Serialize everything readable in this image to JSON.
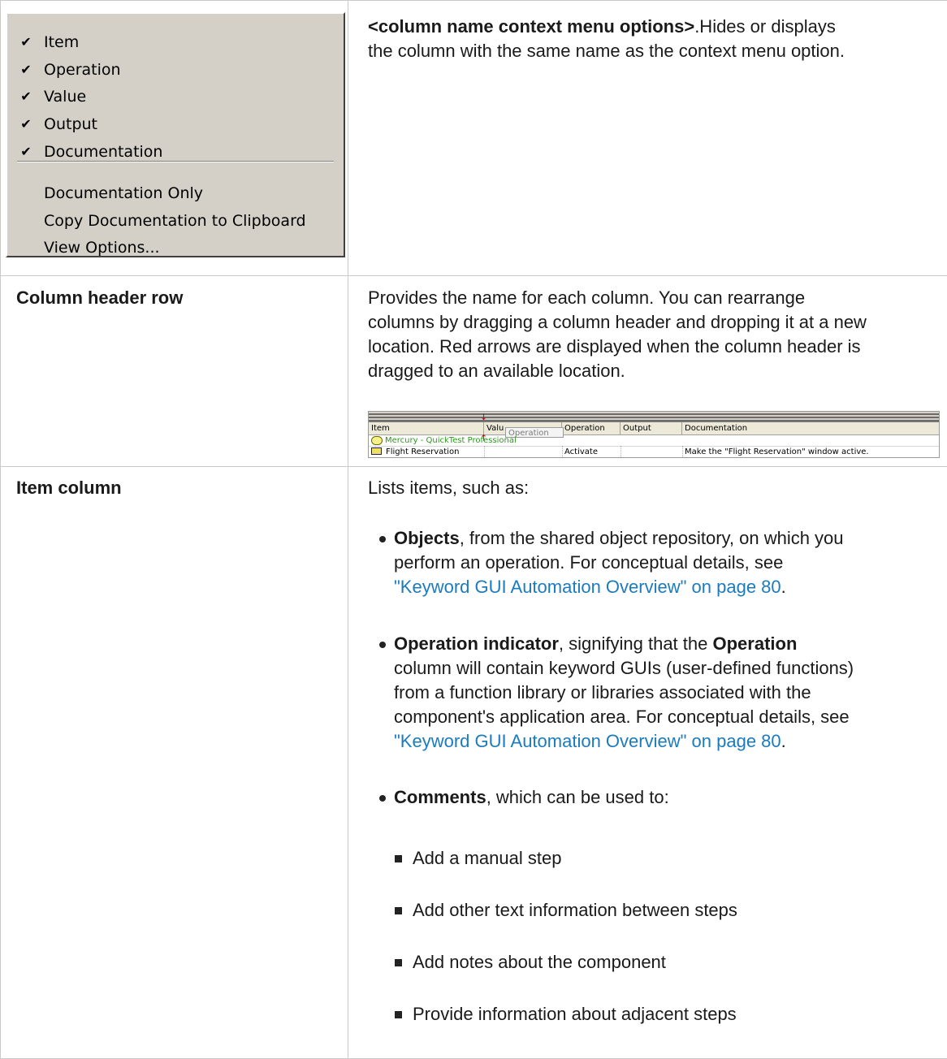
{
  "context_menu": {
    "checked_items": [
      "Item",
      "Operation",
      "Value",
      "Output",
      "Documentation"
    ],
    "other_items": [
      "Documentation Only",
      "Copy Documentation to Clipboard",
      "View Options..."
    ]
  },
  "row1": {
    "term": "<column name context menu options>",
    "desc_line1": ".Hides or displays",
    "desc_line2": "the column with the same name as the context menu option."
  },
  "row2": {
    "term": "Column header row",
    "desc": [
      "Provides the name for each column. You can rearrange",
      "columns by dragging a column header and dropping it at a new",
      "location. Red arrows are displayed when the column header is",
      "dragged to an available location."
    ],
    "grid": {
      "headers": [
        "Item",
        "Valu",
        "Operation",
        "Output",
        "Documentation"
      ],
      "drag_label": "Operation",
      "row1_item": "Mercury - QuickTest Professional",
      "row2": {
        "item": "Flight Reservation",
        "operation": "Activate",
        "documentation": "Make the \"Flight Reservation\" window active."
      }
    }
  },
  "row3": {
    "term": "Item column",
    "intro": "Lists items, such as:",
    "objects_bold": "Objects",
    "objects_l1": ", from the shared object repository, on which you",
    "objects_l2": "perform an operation. For conceptual details, see",
    "objects_link": "\"Keyword GUI Automation Overview\" on page 80",
    "period": ".",
    "opind_bold": "Operation indicator",
    "opind_mid": ", signifying that the ",
    "opind_bold2": "Operation",
    "opind_l2": "column will contain keyword GUIs (user-defined functions)",
    "opind_l3": "from a function library or libraries associated with the",
    "opind_l4": "component's application area. For conceptual details, see",
    "opind_link": "\"Keyword GUI Automation Overview\" on page 80",
    "comments_bold": "Comments",
    "comments_rest": ", which can be used to:",
    "sub_items": [
      "Add a manual step",
      "Add other text information between steps",
      "Add notes about the component",
      "Provide information about adjacent steps"
    ]
  }
}
